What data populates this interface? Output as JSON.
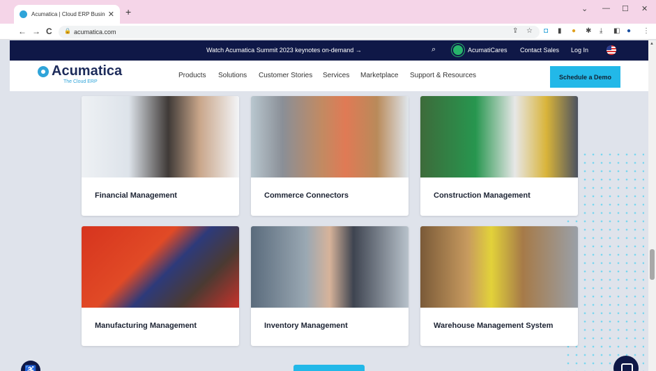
{
  "browser": {
    "tab_title": "Acumatica | Cloud ERP Business",
    "tab_close": "✕",
    "new_tab": "+",
    "window_controls": {
      "minimize": "—",
      "maximize": "☐",
      "close": "✕",
      "chevron": "⌄"
    },
    "nav": {
      "back": "←",
      "forward": "→",
      "reload": "C"
    },
    "url": "acumatica.com"
  },
  "promo_bar": {
    "text": "Watch Acumatica Summit 2023 keynotes on-demand →",
    "acumaticares": "AcumatiCares",
    "contact_sales": "Contact Sales",
    "login": "Log In"
  },
  "site_nav": {
    "logo_text": "Acumatica",
    "logo_tagline": "The Cloud ERP",
    "menu": [
      "Products",
      "Solutions",
      "Customer Stories",
      "Services",
      "Marketplace",
      "Support & Resources"
    ],
    "cta": "Schedule a Demo"
  },
  "cards": [
    {
      "label": "Financial Management"
    },
    {
      "label": "Commerce Connectors"
    },
    {
      "label": "Construction Management"
    },
    {
      "label": "Manufacturing Management"
    },
    {
      "label": "Inventory Management"
    },
    {
      "label": "Warehouse Management System"
    }
  ],
  "colors": {
    "navy": "#0f1847",
    "accent": "#22b8e8",
    "brand_blue": "#2fa4d9",
    "tab_bar": "#f5d5e8"
  }
}
